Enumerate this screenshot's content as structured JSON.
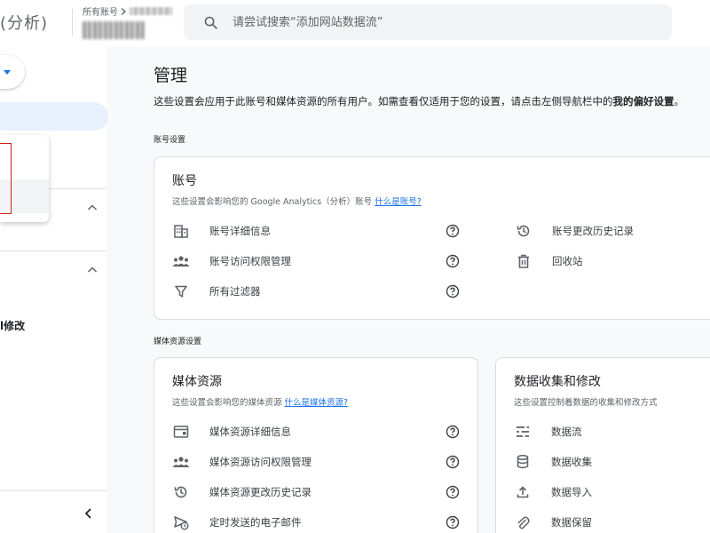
{
  "app": {
    "title": "(分析)"
  },
  "account_picker": {
    "label": "所有账号"
  },
  "search": {
    "placeholder": "请尝试搜索“添加网站数据流”"
  },
  "sidebar": {
    "partial_text": "l修改"
  },
  "main": {
    "title": "管理",
    "description": "这些设置会应用于此账号和媒体资源的所有用户。如需查看仅适用于您的设置，请点击左侧导航栏中的",
    "description_bold": "我的偏好设置",
    "description_end": "。",
    "account_section_label": "账号设置",
    "property_section_label": "媒体资源设置"
  },
  "account_card": {
    "title": "账号",
    "subtitle": "这些设置会影响您的 Google Analytics（分析）账号",
    "subtitle_link": "什么是账号?",
    "items": [
      {
        "label": "账号详细信息",
        "icon": "building-icon"
      },
      {
        "label": "账号访问权限管理",
        "icon": "people-icon"
      },
      {
        "label": "所有过滤器",
        "icon": "filter-icon"
      }
    ],
    "right_items": [
      {
        "label": "账号更改历史记录",
        "icon": "history-icon"
      },
      {
        "label": "回收站",
        "icon": "trash-icon"
      }
    ]
  },
  "property_card": {
    "title": "媒体资源",
    "subtitle": "这些设置会影响您的媒体资源",
    "subtitle_link": "什么是媒体资源?",
    "items": [
      {
        "label": "媒体资源详细信息",
        "icon": "property-details-icon"
      },
      {
        "label": "媒体资源访问权限管理",
        "icon": "people-icon"
      },
      {
        "label": "媒体资源更改历史记录",
        "icon": "history-icon"
      },
      {
        "label": "定时发送的电子邮件",
        "icon": "scheduled-email-icon"
      }
    ]
  },
  "data_card": {
    "title": "数据收集和修改",
    "subtitle": "这些设置控制着数据的收集和修改方式",
    "items": [
      {
        "label": "数据流",
        "icon": "data-streams-icon"
      },
      {
        "label": "数据收集",
        "icon": "database-icon"
      },
      {
        "label": "数据导入",
        "icon": "upload-icon"
      },
      {
        "label": "数据保留",
        "icon": "attach-icon"
      }
    ]
  },
  "colors": {
    "accent": "#1a73e8",
    "highlight": "#c5221f",
    "active_bg": "#e8f0fe"
  }
}
